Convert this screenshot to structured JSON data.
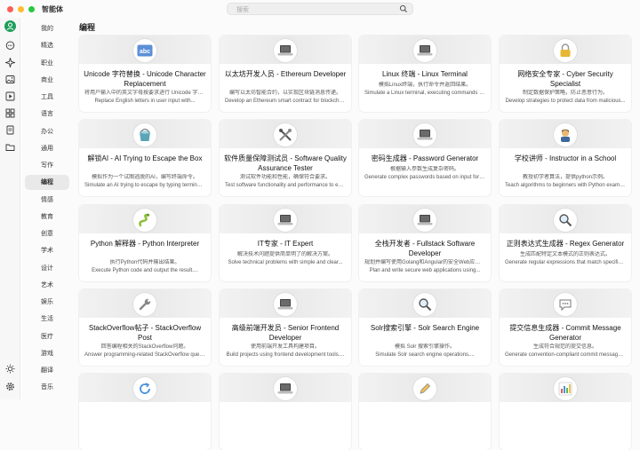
{
  "app": {
    "title": "智能体"
  },
  "search": {
    "placeholder": "搜索"
  },
  "rail": {
    "icons": [
      "user-avatar-icon",
      "chat-icon",
      "sparkle-icon",
      "image-icon",
      "media-icon",
      "grid-icon",
      "document-icon",
      "folder-icon",
      "sun-icon",
      "settings-icon"
    ]
  },
  "categories": [
    "我的",
    "精选",
    "职业",
    "商业",
    "工具",
    "语言",
    "办公",
    "通用",
    "写作",
    "编程",
    "情感",
    "教育",
    "创意",
    "学术",
    "设计",
    "艺术",
    "娱乐",
    "生活",
    "医疗",
    "游戏",
    "翻译",
    "音乐"
  ],
  "active_category": "编程",
  "section": {
    "title": "编程"
  },
  "cards": [
    {
      "title": "Unicode 字符替换 - Unicode Character Replacement",
      "desc1": "将用户输入中的英文字母按要求进行 Unicode 字符替换。",
      "desc2": "Replace English letters in user input with...",
      "icon": "abc-icon"
    },
    {
      "title": "以太坊开发人员 - Ethereum Developer",
      "desc1": "编写以太坊智能合约，以实现区块链消息传递。",
      "desc2": "Develop an Ethereum smart contract for blockchai...",
      "icon": "laptop-icon"
    },
    {
      "title": "Linux 终端 - Linux Terminal",
      "desc1": "模拟Linux终端，执行命令并返回结果。",
      "desc2": "Simulate a Linux terminal, executing commands and returnin...",
      "icon": "laptop-icon"
    },
    {
      "title": "网络安全专家 - Cyber Security Specialist",
      "desc1": "制定数据保护策略，防止恶意行为。",
      "desc2": "Develop strategies to protect data from malicious...",
      "icon": "lock-icon"
    },
    {
      "title": "解锁AI - AI Trying to Escape the Box",
      "desc1": "模拟作为一个试图逃脱的AI，编写终端命令。",
      "desc2": "Simulate an AI trying to escape by typing terminal...",
      "icon": "bucket-icon"
    },
    {
      "title": "软件质量保障测试员 - Software Quality Assurance Tester",
      "desc1": "测试软件功能和性能，确保符合要求。",
      "desc2": "Test software functionality and performance to ensure it meets...",
      "icon": "tools-icon"
    },
    {
      "title": "密码生成器 - Password Generator",
      "desc1": "根据输入参数生成复杂密码。",
      "desc2": "Generate complex passwords based on input forms....",
      "icon": "laptop-icon"
    },
    {
      "title": "学校讲师 - Instructor in a School",
      "desc1": "教授初学者算法，提供python示例。",
      "desc2": "Teach algorithms to beginners with Python examples....",
      "icon": "teacher-icon"
    },
    {
      "title": "Python 解释器 - Python Interpreter",
      "desc1": "执行Python代码并输出结果。",
      "desc2": "Execute Python code and output the result....",
      "icon": "snake-icon"
    },
    {
      "title": "IT专家 - IT Expert",
      "desc1": "解决技术问题提供简单明了的解决方案。",
      "desc2": "Solve technical problems with simple and clear...",
      "icon": "laptop-icon"
    },
    {
      "title": "全栈开发者 - Fullstack Software Developer",
      "desc1": "规划并编写使用Golang和Angular的安全Web应用。",
      "desc2": "Plan and write secure web applications using...",
      "icon": "laptop-icon"
    },
    {
      "title": "正则表达式生成器 - Regex Generator",
      "desc1": "生成匹配特定文本模式的正则表达式。",
      "desc2": "Generate regular expressions that match specific text...",
      "icon": "magnifier-icon"
    },
    {
      "title": "StackOverflow帖子 - StackOverflow Post",
      "desc1": "回答编程相关的StackOverflow问题。",
      "desc2": "Answer programming-related StackOverflow questions....",
      "icon": "wrench-icon"
    },
    {
      "title": "高级前端开发员 - Senior Frontend Developer",
      "desc1": "使用前端开发工具构建项目。",
      "desc2": "Build projects using frontend development tools....",
      "icon": "laptop-icon"
    },
    {
      "title": "Solr搜索引擎 - Solr Search Engine",
      "desc1": "模拟 Solr 搜索引擎操作。",
      "desc2": "Simulate Solr search engine operations....",
      "icon": "magnifier-icon"
    },
    {
      "title": "提交信息生成器 - Commit Message Generator",
      "desc1": "生成符合规范的提交信息。",
      "desc2": "Generate convention-compliant commit messages....",
      "icon": "speech-icon"
    },
    {
      "title": "",
      "desc1": "",
      "desc2": "",
      "icon": "refresh-icon"
    },
    {
      "title": "",
      "desc1": "",
      "desc2": "",
      "icon": "laptop-icon"
    },
    {
      "title": "",
      "desc1": "",
      "desc2": "",
      "icon": "pencil-icon"
    },
    {
      "title": "",
      "desc1": "",
      "desc2": "",
      "icon": "chart-icon"
    }
  ],
  "colors": {
    "traffic_red": "#ff5f57",
    "traffic_yellow": "#febc2e",
    "traffic_green": "#28c840",
    "accent": "#1e9e5a"
  }
}
